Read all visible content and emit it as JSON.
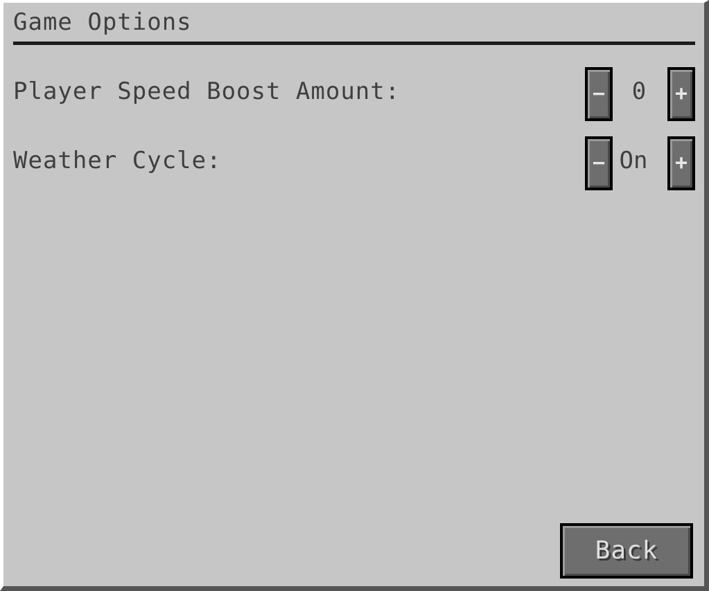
{
  "title": "Game Options",
  "options": [
    {
      "label": "Player Speed Boost Amount:",
      "decrement_label": "−",
      "value": "0",
      "increment_label": "+"
    },
    {
      "label": "Weather Cycle:",
      "decrement_label": "−",
      "value": "On",
      "increment_label": "+"
    }
  ],
  "back_label": "Back",
  "colors": {
    "panel": "#c6c6c6",
    "text": "#3f3f3f",
    "button": "#6e6e6e",
    "button_border": "#000000"
  }
}
